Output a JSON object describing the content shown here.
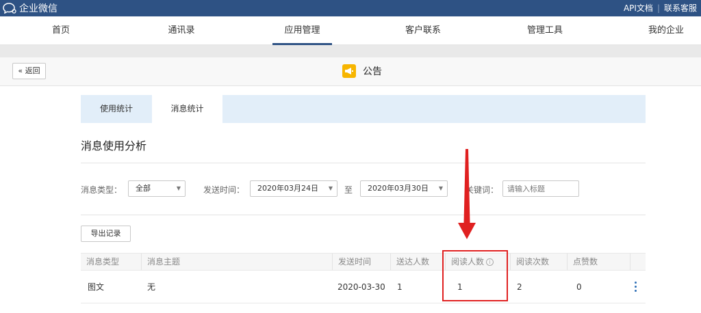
{
  "topbar": {
    "brand": "企业微信",
    "links": [
      "API文档",
      "联系客服"
    ],
    "sep": "|"
  },
  "nav": {
    "items": [
      "首页",
      "通讯录",
      "应用管理",
      "客户联系",
      "管理工具",
      "我的企业"
    ],
    "active_index": 2
  },
  "subhead": {
    "back_label": "« 返回",
    "title": "公告"
  },
  "tabs": {
    "items": [
      "使用统计",
      "消息统计"
    ],
    "active_index": 1
  },
  "section_title": "消息使用分析",
  "filters": {
    "type_label": "消息类型：",
    "type_value": "全部",
    "time_label": "发送时间：",
    "start_date": "2020年03月24日",
    "to_label": "至",
    "end_date": "2020年03月30日",
    "keyword_label": "关键词：",
    "keyword_placeholder": "请输入标题"
  },
  "export_label": "导出记录",
  "table": {
    "headers": [
      "消息类型",
      "消息主题",
      "发送时间",
      "送达人数",
      "阅读人数",
      "阅读次数",
      "点赞数"
    ],
    "rows": [
      [
        "图文",
        "无",
        "2020-03-30",
        "1",
        "1",
        "2",
        "0"
      ]
    ]
  },
  "colors": {
    "topbar": "#2e5284",
    "tab_bar": "#e2eef9",
    "highlight": "#e02020",
    "app_icon": "#f7b500"
  },
  "icons": [
    "chat-bubble-icon",
    "megaphone-icon",
    "info-icon",
    "more-vertical-icon",
    "down-arrow-annotation"
  ]
}
